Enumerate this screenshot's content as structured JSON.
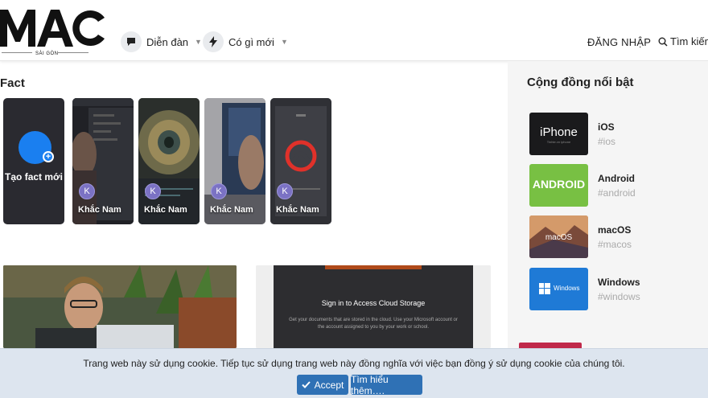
{
  "header": {
    "logo_text": "MAC",
    "logo_sub": "SÀI GÒN",
    "nav": [
      {
        "label": "Diễn đàn",
        "icon": "comment-icon"
      },
      {
        "label": "Có gì mới",
        "icon": "bolt-icon"
      }
    ],
    "login_label": "ĐĂNG NHẬP",
    "search_label": "Tìm kiếm"
  },
  "facts": {
    "title": "Fact",
    "create_label": "Tạo fact mới",
    "cards": [
      {
        "author": "Khắc Nam",
        "initial": "K"
      },
      {
        "author": "Khắc Nam",
        "initial": "K"
      },
      {
        "author": "Khắc Nam",
        "initial": "K"
      },
      {
        "author": "Khắc Nam",
        "initial": "K"
      }
    ]
  },
  "articles": {
    "cloud_title": "Sign in to Access Cloud Storage",
    "cloud_body": "Get your documents that are stored in the cloud. Use your Microsoft account or the account assigned to you by your work or school."
  },
  "sidebar": {
    "title": "Cộng đồng nổi bật",
    "communities": [
      {
        "name": "iOS",
        "tag": "#ios",
        "thumb_text": "iPhone",
        "thumb_sub": "Tinhte.vn iphone"
      },
      {
        "name": "Android",
        "tag": "#android",
        "thumb_text": "ANDROID"
      },
      {
        "name": "macOS",
        "tag": "#macos",
        "thumb_text": "macOS"
      },
      {
        "name": "Windows",
        "tag": "#windows",
        "thumb_text": "Windows"
      }
    ]
  },
  "cookie": {
    "text": "Trang web này sử dụng cookie. Tiếp tục sử dụng trang web này đồng nghĩa với việc bạn đồng ý sử dụng cookie của chúng tôi.",
    "accept_label": "Accept",
    "more_label": "Tìm hiểu thêm…."
  },
  "colors": {
    "accent": "#2f71b5",
    "fact_avatar": "#7b72c4",
    "create_fact_blue": "#1a7ff0",
    "android_green": "#78c043",
    "windows_blue": "#1f7ad6"
  }
}
